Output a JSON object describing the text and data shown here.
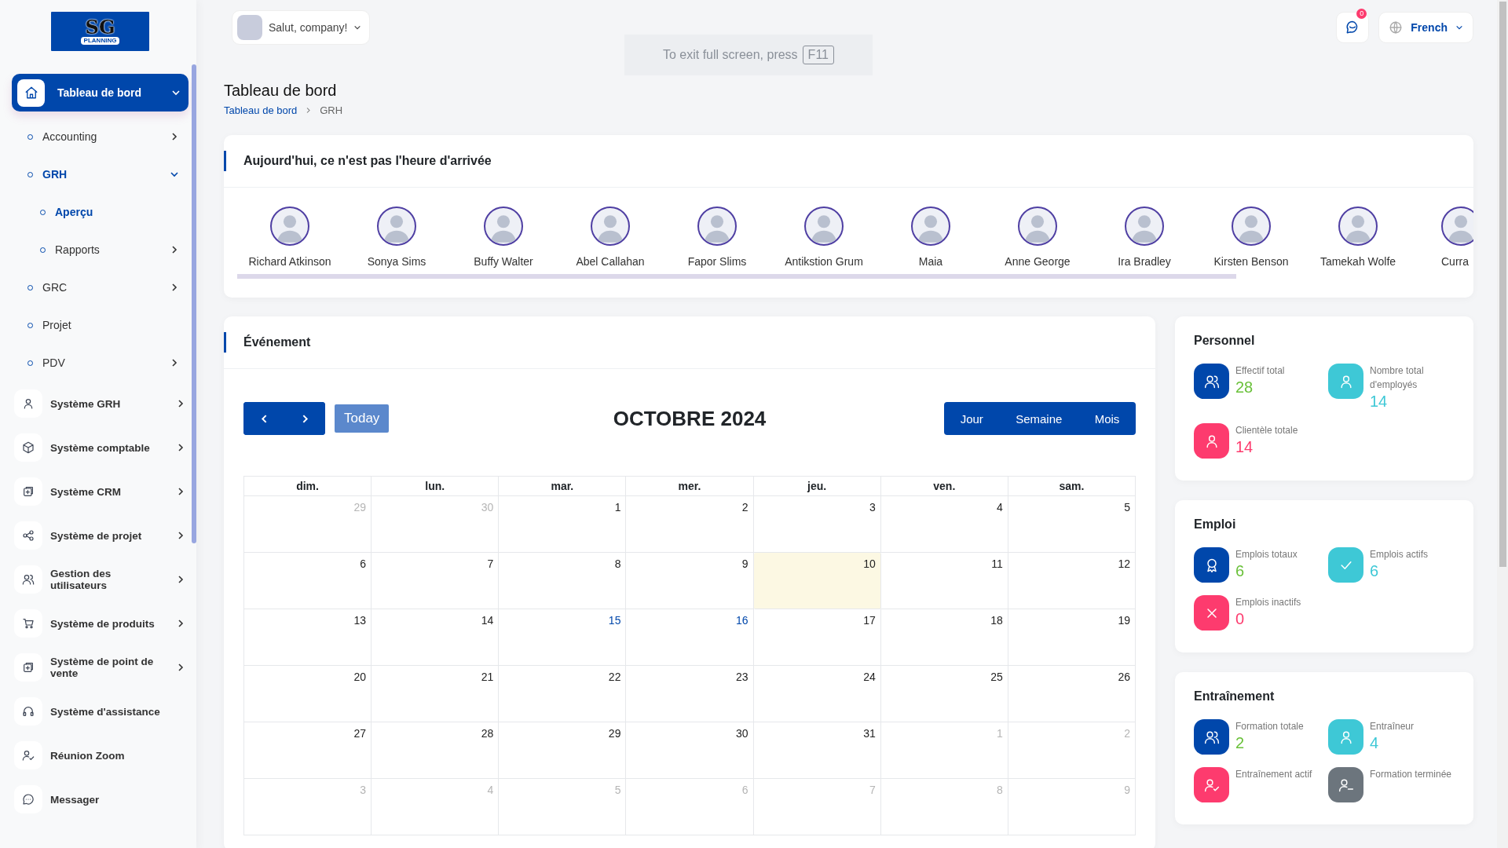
{
  "logo": {
    "monogram": "SG",
    "tagline": "PLANNING"
  },
  "header": {
    "greeting": "Salut, company!",
    "notifications": "0",
    "language": "French"
  },
  "fullscreen_notice": {
    "text": "To exit full screen, press",
    "key": "F11"
  },
  "page": {
    "title": "Tableau de bord",
    "breadcrumb": [
      "Tableau de bord",
      "GRH"
    ]
  },
  "sidebar": {
    "items": [
      {
        "label": "Tableau de bord",
        "kind": "primary",
        "selected": true,
        "expandable": true,
        "expanded": true,
        "children": [
          {
            "label": "Accounting",
            "kind": "sub",
            "selected": false,
            "expandable": true,
            "expanded": false
          },
          {
            "label": "GRH",
            "kind": "sub",
            "selected": true,
            "expandable": true,
            "expanded": true,
            "children": [
              {
                "label": "Aperçu",
                "kind": "sub",
                "selected": true,
                "expandable": false,
                "expanded": false
              },
              {
                "label": "Rapports",
                "kind": "sub",
                "selected": false,
                "expandable": true,
                "expanded": false
              }
            ]
          },
          {
            "label": "GRC",
            "kind": "sub",
            "selected": false,
            "expandable": true,
            "expanded": false
          },
          {
            "label": "Projet",
            "kind": "sub",
            "selected": false,
            "expandable": false,
            "expanded": false
          },
          {
            "label": "PDV",
            "kind": "sub",
            "selected": false,
            "expandable": true,
            "expanded": false
          }
        ]
      },
      {
        "label": "Système GRH",
        "kind": "main",
        "selected": false,
        "expandable": true,
        "expanded": false
      },
      {
        "label": "Système comptable",
        "kind": "main",
        "selected": false,
        "expandable": true,
        "expanded": false
      },
      {
        "label": "Système CRM",
        "kind": "main",
        "selected": false,
        "expandable": true,
        "expanded": false
      },
      {
        "label": "Système de projet",
        "kind": "main",
        "selected": false,
        "expandable": true,
        "expanded": false
      },
      {
        "label": "Gestion des utilisateurs",
        "kind": "main",
        "selected": false,
        "expandable": true,
        "expanded": false
      },
      {
        "label": "Système de produits",
        "kind": "main",
        "selected": false,
        "expandable": true,
        "expanded": false
      },
      {
        "label": "Système de point de vente",
        "kind": "main",
        "selected": false,
        "expandable": true,
        "expanded": false
      },
      {
        "label": "Système d'assistance",
        "kind": "main",
        "selected": false,
        "expandable": false,
        "expanded": false
      },
      {
        "label": "Réunion Zoom",
        "kind": "main",
        "selected": false,
        "expandable": false,
        "expanded": false
      },
      {
        "label": "Messager",
        "kind": "main",
        "selected": false,
        "expandable": false,
        "expanded": false
      }
    ]
  },
  "attendance": {
    "title": "Aujourd'hui, ce n'est pas l'heure d'arrivée",
    "people": [
      {
        "name": "Richard Atkinson"
      },
      {
        "name": "Sonya Sims"
      },
      {
        "name": "Buffy Walter"
      },
      {
        "name": "Abel Callahan"
      },
      {
        "name": "Fapor Slims"
      },
      {
        "name": "Antikstion Grum"
      },
      {
        "name": "Maia"
      },
      {
        "name": "Anne George"
      },
      {
        "name": "Ira Bradley"
      },
      {
        "name": "Kirsten Benson"
      },
      {
        "name": "Tamekah Wolfe"
      },
      {
        "name": "Curra"
      }
    ]
  },
  "events": {
    "title": "Événement",
    "today_button": "Today",
    "month": "OCTOBRE 2024",
    "views": [
      "Jour",
      "Semaine",
      "Mois"
    ],
    "weekdays": [
      "dim.",
      "lun.",
      "mar.",
      "mer.",
      "jeu.",
      "ven.",
      "sam."
    ],
    "weeks": [
      [
        {
          "day": "29",
          "muted": true,
          "today": false,
          "marked": false
        },
        {
          "day": "30",
          "muted": true,
          "today": false,
          "marked": false
        },
        {
          "day": "1",
          "muted": false,
          "today": false,
          "marked": false
        },
        {
          "day": "2",
          "muted": false,
          "today": false,
          "marked": false
        },
        {
          "day": "3",
          "muted": false,
          "today": false,
          "marked": false
        },
        {
          "day": "4",
          "muted": false,
          "today": false,
          "marked": false
        },
        {
          "day": "5",
          "muted": false,
          "today": false,
          "marked": false
        }
      ],
      [
        {
          "day": "6",
          "muted": false,
          "today": false,
          "marked": false
        },
        {
          "day": "7",
          "muted": false,
          "today": false,
          "marked": false
        },
        {
          "day": "8",
          "muted": false,
          "today": false,
          "marked": false
        },
        {
          "day": "9",
          "muted": false,
          "today": false,
          "marked": false
        },
        {
          "day": "10",
          "muted": false,
          "today": true,
          "marked": false
        },
        {
          "day": "11",
          "muted": false,
          "today": false,
          "marked": false
        },
        {
          "day": "12",
          "muted": false,
          "today": false,
          "marked": false
        }
      ],
      [
        {
          "day": "13",
          "muted": false,
          "today": false,
          "marked": false
        },
        {
          "day": "14",
          "muted": false,
          "today": false,
          "marked": false
        },
        {
          "day": "15",
          "muted": false,
          "today": false,
          "marked": true
        },
        {
          "day": "16",
          "muted": false,
          "today": false,
          "marked": true
        },
        {
          "day": "17",
          "muted": false,
          "today": false,
          "marked": false
        },
        {
          "day": "18",
          "muted": false,
          "today": false,
          "marked": false
        },
        {
          "day": "19",
          "muted": false,
          "today": false,
          "marked": false
        }
      ],
      [
        {
          "day": "20",
          "muted": false,
          "today": false,
          "marked": false
        },
        {
          "day": "21",
          "muted": false,
          "today": false,
          "marked": false
        },
        {
          "day": "22",
          "muted": false,
          "today": false,
          "marked": false
        },
        {
          "day": "23",
          "muted": false,
          "today": false,
          "marked": false
        },
        {
          "day": "24",
          "muted": false,
          "today": false,
          "marked": false
        },
        {
          "day": "25",
          "muted": false,
          "today": false,
          "marked": false
        },
        {
          "day": "26",
          "muted": false,
          "today": false,
          "marked": false
        }
      ],
      [
        {
          "day": "27",
          "muted": false,
          "today": false,
          "marked": false
        },
        {
          "day": "28",
          "muted": false,
          "today": false,
          "marked": false
        },
        {
          "day": "29",
          "muted": false,
          "today": false,
          "marked": false
        },
        {
          "day": "30",
          "muted": false,
          "today": false,
          "marked": false
        },
        {
          "day": "31",
          "muted": false,
          "today": false,
          "marked": false
        },
        {
          "day": "1",
          "muted": true,
          "today": false,
          "marked": false
        },
        {
          "day": "2",
          "muted": true,
          "today": false,
          "marked": false
        }
      ],
      [
        {
          "day": "3",
          "muted": true,
          "today": false,
          "marked": false
        },
        {
          "day": "4",
          "muted": true,
          "today": false,
          "marked": false
        },
        {
          "day": "5",
          "muted": true,
          "today": false,
          "marked": false
        },
        {
          "day": "6",
          "muted": true,
          "today": false,
          "marked": false
        },
        {
          "day": "7",
          "muted": true,
          "today": false,
          "marked": false
        },
        {
          "day": "8",
          "muted": true,
          "today": false,
          "marked": false
        },
        {
          "day": "9",
          "muted": true,
          "today": false,
          "marked": false
        }
      ]
    ]
  },
  "stats": [
    {
      "title": "Personnel",
      "items": [
        {
          "label": "Effectif total",
          "value": "28",
          "color": "#0047ab"
        },
        {
          "label": "Nombre total d'employés",
          "value": "14",
          "color": "#3ec8d6"
        },
        {
          "label": "Clientèle totale",
          "value": "14",
          "color": "#fd3b6e"
        }
      ]
    },
    {
      "title": "Emploi",
      "items": [
        {
          "label": "Emplois totaux",
          "value": "6",
          "color": "#0047ab"
        },
        {
          "label": "Emplois actifs",
          "value": "6",
          "color": "#3ec8d6"
        },
        {
          "label": "Emplois inactifs",
          "value": "0",
          "color": "#fd3b6e"
        }
      ]
    },
    {
      "title": "Entraînement",
      "items": [
        {
          "label": "Formation totale",
          "value": "2",
          "color": "#0047ab"
        },
        {
          "label": "Entraîneur",
          "value": "4",
          "color": "#3ec8d6"
        },
        {
          "label": "Entraînement actif",
          "color": "#fd3b6e"
        },
        {
          "label": "Formation terminée",
          "color": "#6c757d"
        }
      ]
    }
  ]
}
